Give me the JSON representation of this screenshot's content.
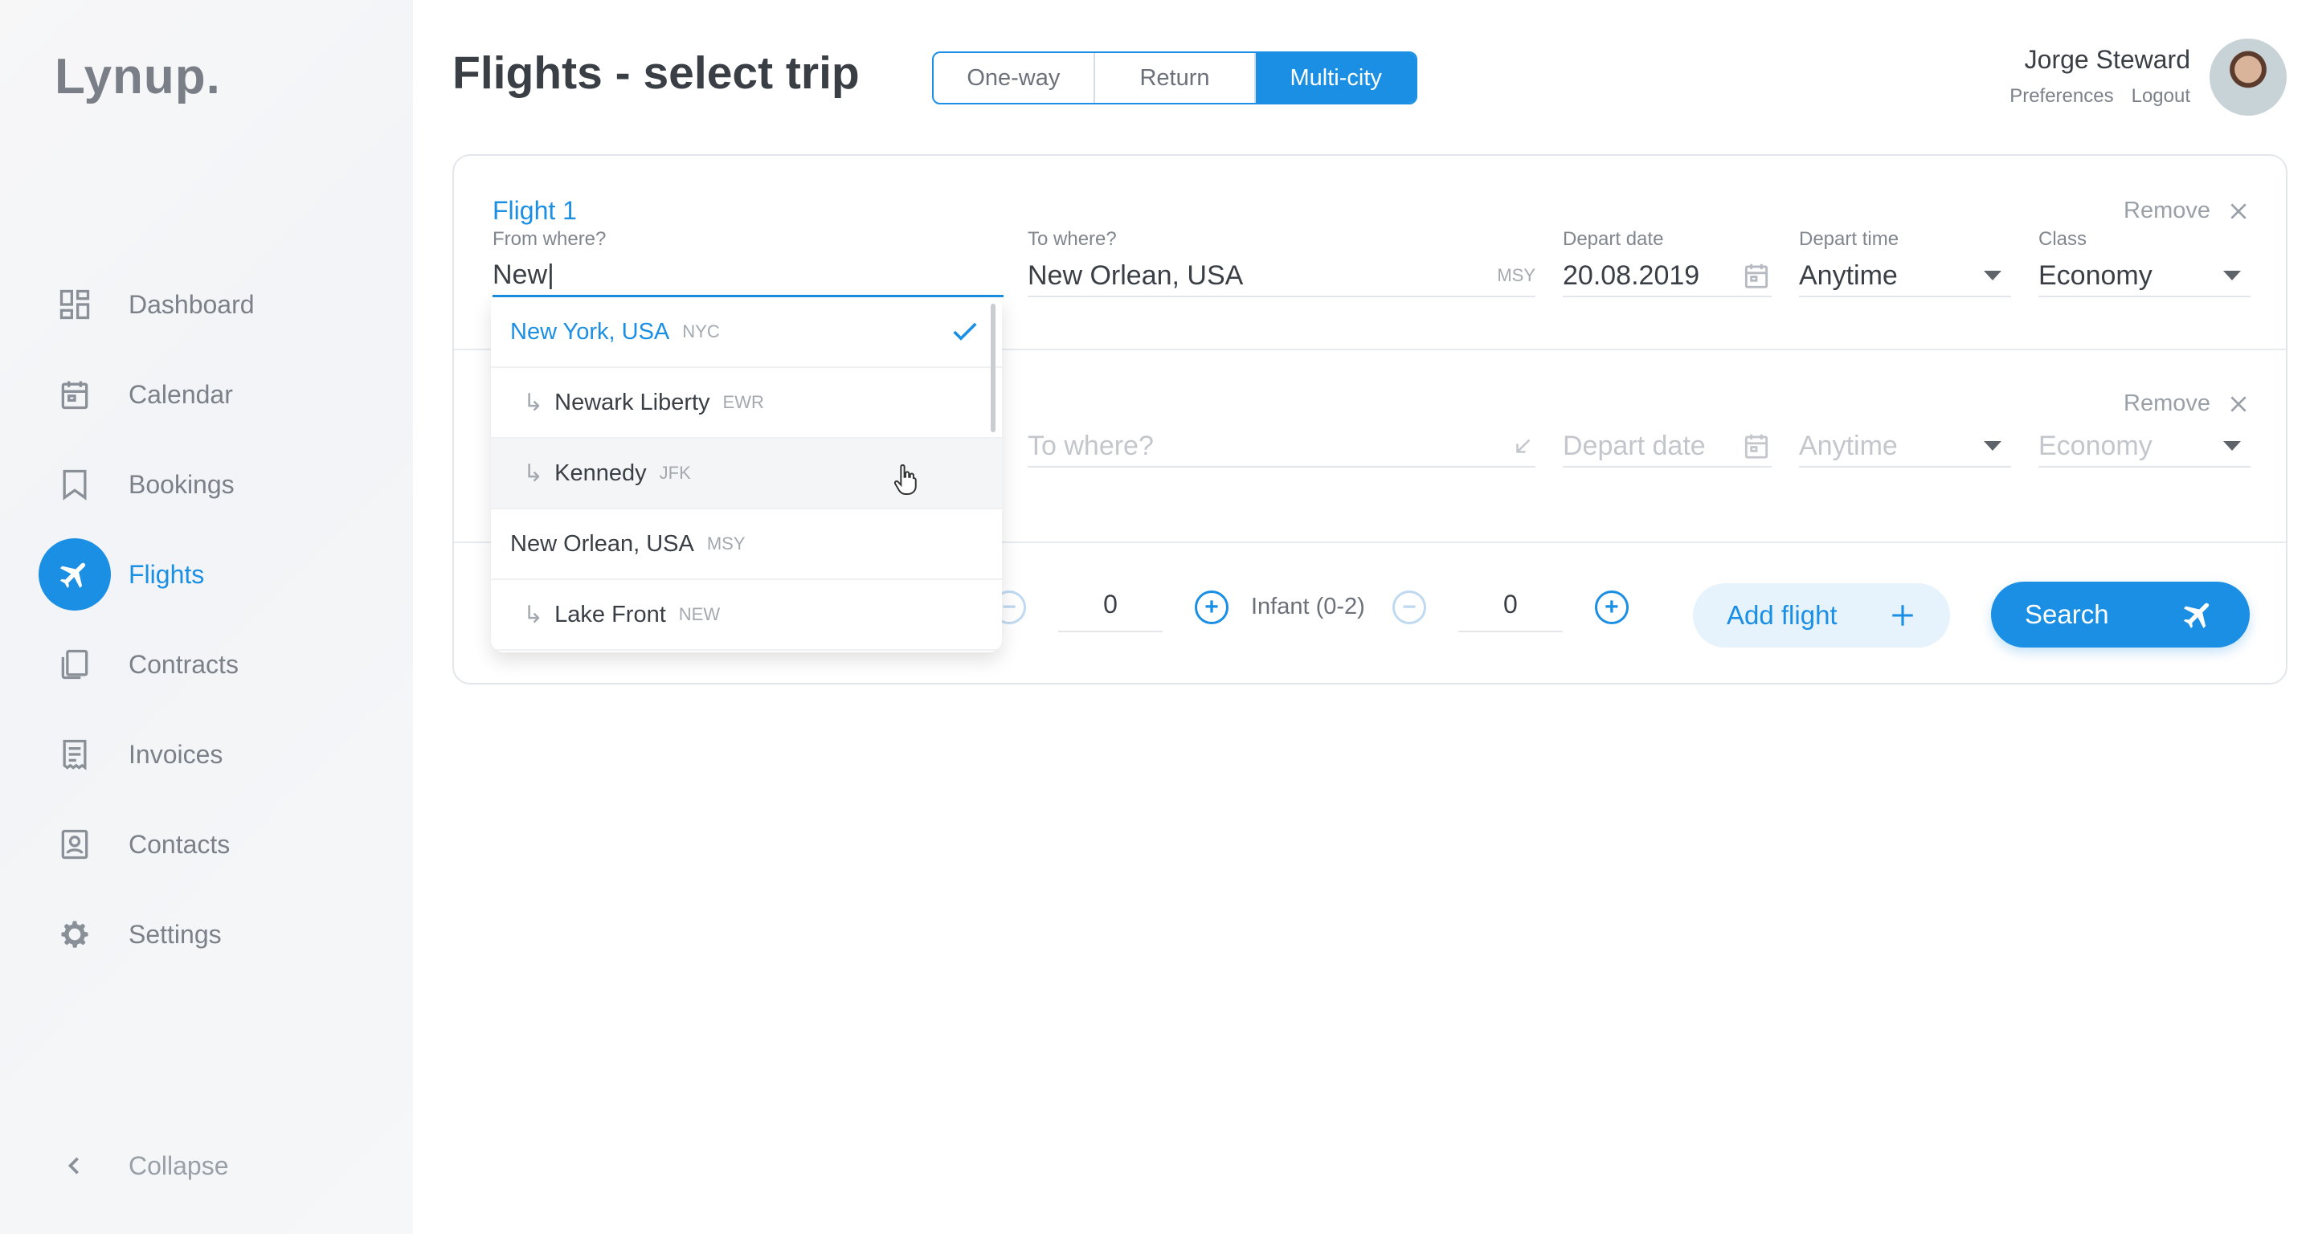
{
  "app": {
    "logo": "Lynup."
  },
  "sidebar": {
    "items": [
      {
        "label": "Dashboard",
        "icon": "dashboard-icon"
      },
      {
        "label": "Calendar",
        "icon": "calendar-icon"
      },
      {
        "label": "Bookings",
        "icon": "bookmark-icon"
      },
      {
        "label": "Flights",
        "icon": "airplane-icon",
        "active": true
      },
      {
        "label": "Contracts",
        "icon": "documents-icon"
      },
      {
        "label": "Invoices",
        "icon": "receipt-icon"
      },
      {
        "label": "Contacts",
        "icon": "contact-card-icon"
      },
      {
        "label": "Settings",
        "icon": "gear-icon"
      }
    ],
    "collapse_label": "Collapse"
  },
  "header": {
    "title": "Flights - select trip",
    "trip_types": [
      "One-way",
      "Return",
      "Multi-city"
    ],
    "selected_trip_type": "Multi-city"
  },
  "user": {
    "name": "Jorge Steward",
    "preferences_label": "Preferences",
    "logout_label": "Logout"
  },
  "flights": [
    {
      "title": "Flight 1",
      "remove_label": "Remove",
      "from": {
        "label": "From where?",
        "value": "New|"
      },
      "to": {
        "label": "To where?",
        "value": "New Orlean, USA",
        "code": "MSY"
      },
      "depart_date": {
        "label": "Depart date",
        "value": "20.08.2019"
      },
      "depart_time": {
        "label": "Depart time",
        "value": "Anytime"
      },
      "class": {
        "label": "Class",
        "value": "Economy"
      }
    },
    {
      "title": "",
      "remove_label": "Remove",
      "to": {
        "placeholder": "To where?"
      },
      "depart_date": {
        "placeholder": "Depart date"
      },
      "depart_time": {
        "value": "Anytime"
      },
      "class": {
        "value": "Economy"
      }
    }
  ],
  "passengers": {
    "unlabeled_count": "0",
    "infant_label": "Infant (0-2)",
    "infant_count": "0"
  },
  "actions": {
    "add_flight_label": "Add flight",
    "search_label": "Search"
  },
  "dropdown": {
    "items": [
      {
        "name": "New York, USA",
        "code": "NYC",
        "sub": false,
        "selected": true
      },
      {
        "name": "Newark Liberty",
        "code": "EWR",
        "sub": true
      },
      {
        "name": "Kennedy",
        "code": "JFK",
        "sub": true,
        "hover": true
      },
      {
        "name": "New Orlean, USA",
        "code": "MSY",
        "sub": false
      },
      {
        "name": "Lake Front",
        "code": "NEW",
        "sub": true
      }
    ]
  },
  "colors": {
    "accent": "#1a8fe3",
    "text": "#3a3f45",
    "muted": "#7c8189"
  }
}
